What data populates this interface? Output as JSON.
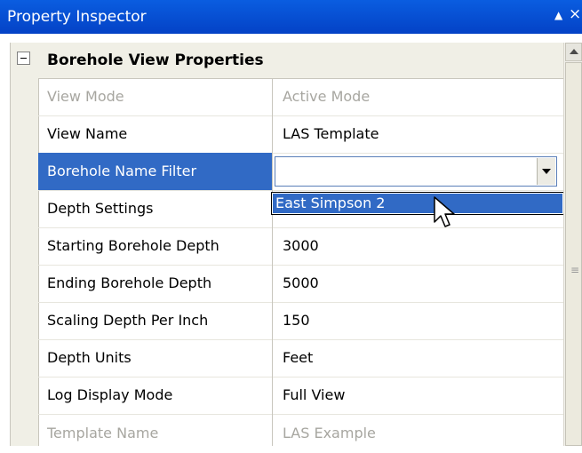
{
  "window": {
    "title": "Property Inspector",
    "pin_glyph": "▲",
    "close_glyph": "×"
  },
  "group": {
    "title": "Borehole View Properties"
  },
  "rows": [
    {
      "name": "View Mode",
      "value": "Active Mode",
      "disabled": true
    },
    {
      "name": "View Name",
      "value": "LAS Template",
      "disabled": false
    },
    {
      "name": "Borehole Name Filter",
      "value": "",
      "selected": true
    },
    {
      "name": "Depth Settings",
      "value": "",
      "disabled": false
    },
    {
      "name": "Starting Borehole Depth",
      "value": "3000",
      "disabled": false
    },
    {
      "name": "Ending Borehole Depth",
      "value": "5000",
      "disabled": false
    },
    {
      "name": "Scaling Depth Per Inch",
      "value": "150",
      "disabled": false
    },
    {
      "name": "Depth Units",
      "value": "Feet",
      "disabled": false
    },
    {
      "name": "Log Display Mode",
      "value": "Full View",
      "disabled": false
    },
    {
      "name": "Template Name",
      "value": "LAS Example",
      "disabled": true
    }
  ],
  "dropdown": {
    "options": [
      "East Simpson 2"
    ],
    "highlighted": "East Simpson 2"
  },
  "colors": {
    "titlebar": "#0a5de0",
    "selection": "#316ac5",
    "disabled_text": "#a7a6a0"
  }
}
